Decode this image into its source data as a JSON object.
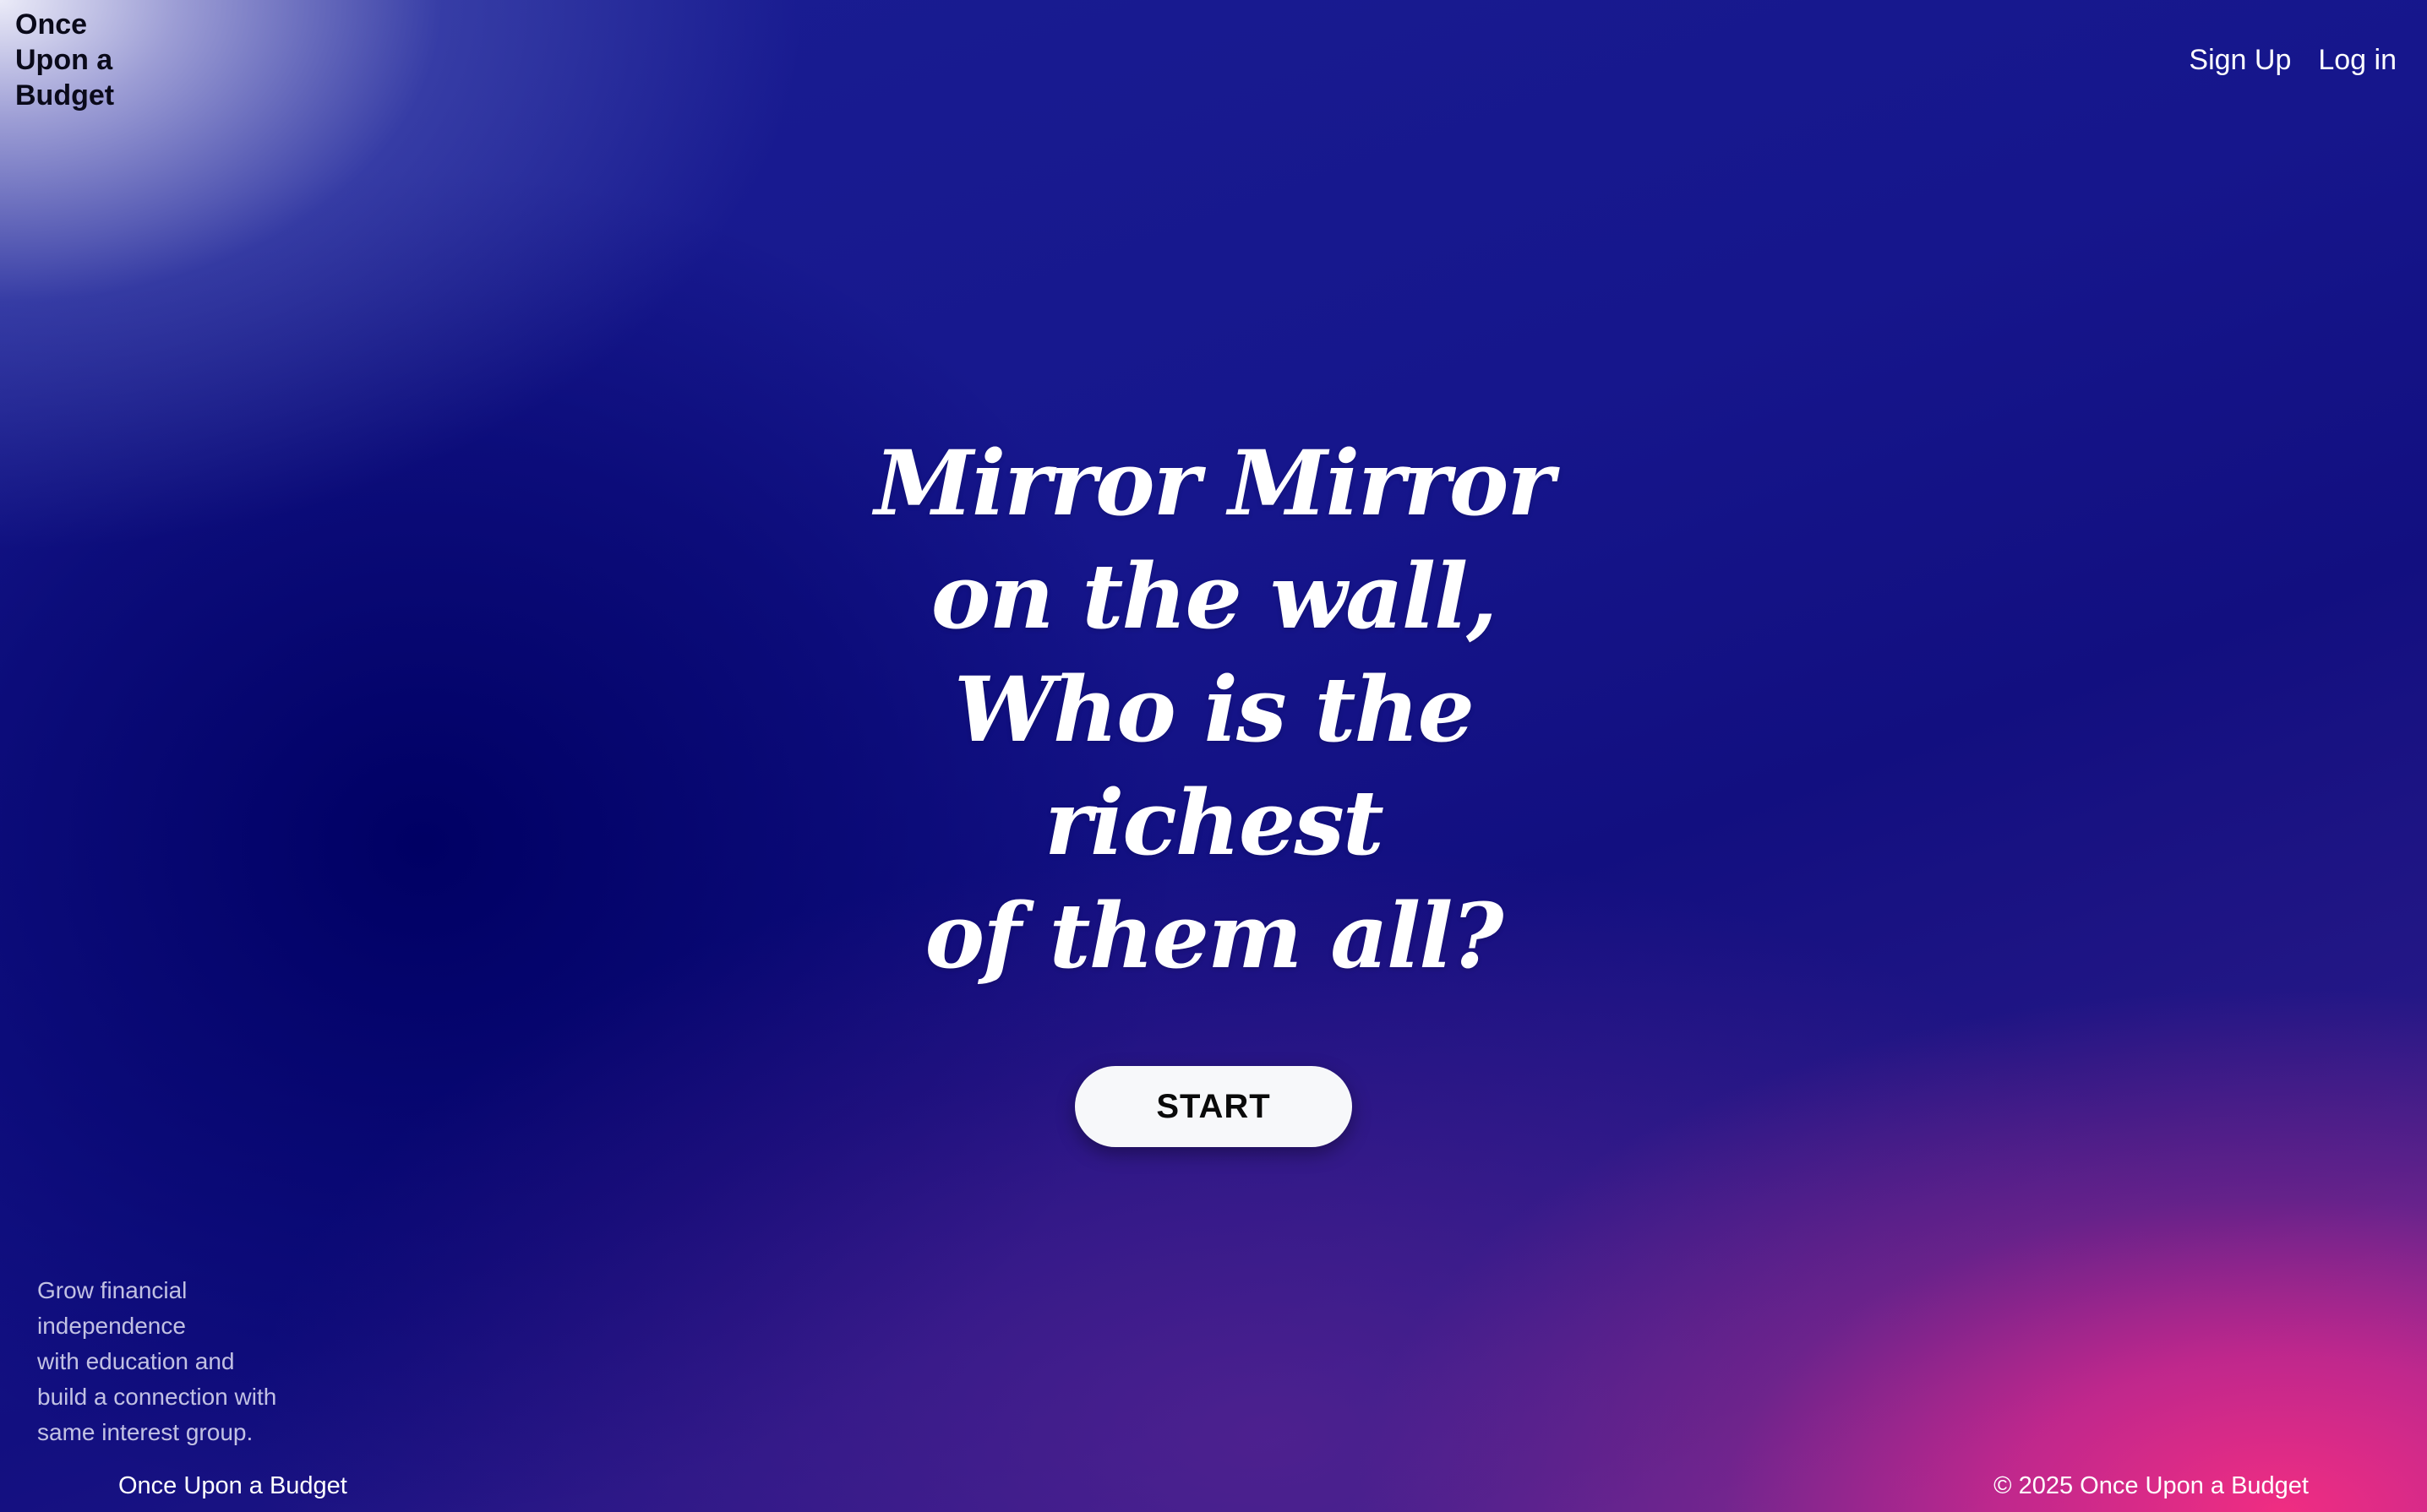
{
  "header": {
    "brand_lines": [
      "Once",
      "Upon a",
      "Budget"
    ],
    "nav": {
      "signup_label": "Sign Up",
      "login_label": "Log in"
    }
  },
  "hero": {
    "lines": [
      "Mirror Mirror",
      "on the wall,",
      "Who is the",
      "richest",
      "of them all?"
    ],
    "start_label": "START"
  },
  "tagline": {
    "lines": [
      "Grow financial",
      "independence",
      "with education and",
      "build a connection with",
      "same interest group."
    ]
  },
  "footer": {
    "left_text": "Once Upon a Budget",
    "right_text": "© 2025 Once Upon a Budget"
  },
  "colors": {
    "background_primary": "#16168c",
    "background_accent": "#f02d82",
    "top_left_glow": "#ebebf8",
    "button_bg": "#f7f8fa",
    "text_light": "#ffffff",
    "brand_text": "#0a0a1a"
  }
}
